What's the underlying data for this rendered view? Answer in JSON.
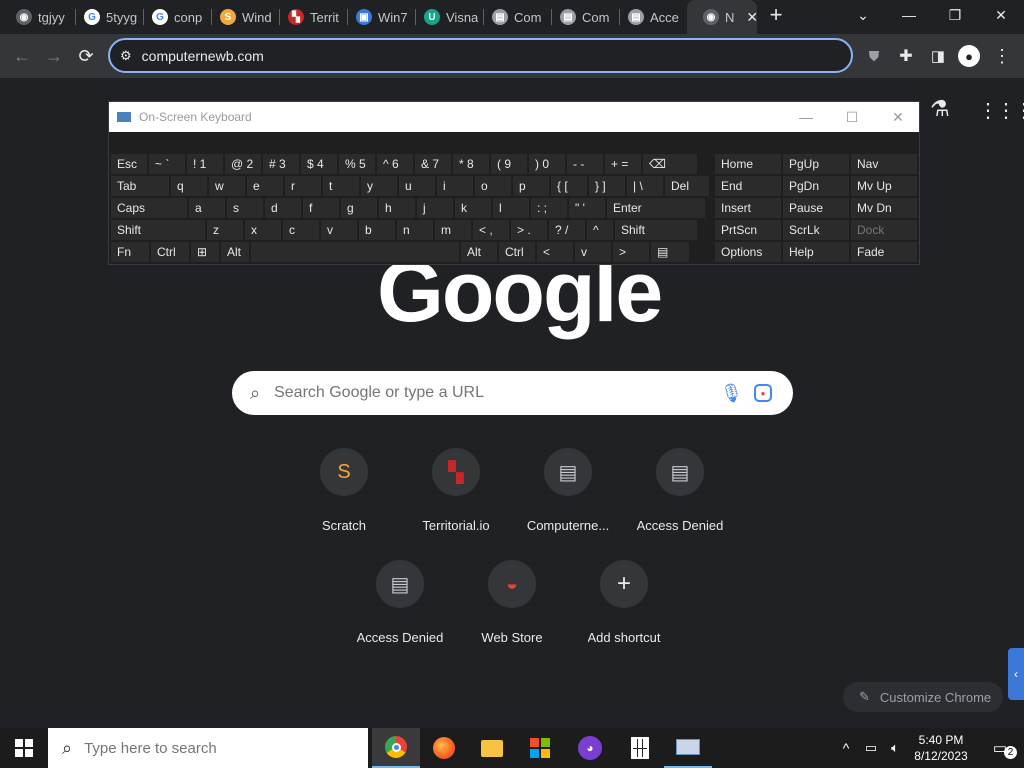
{
  "tabs": [
    {
      "title": "tgjyy",
      "icon": "chrome-icon"
    },
    {
      "title": "5tyyg",
      "icon": "google-icon"
    },
    {
      "title": "conp",
      "icon": "google-icon"
    },
    {
      "title": "Wind",
      "icon": "scratch-icon"
    },
    {
      "title": "Territ",
      "icon": "territorial-icon"
    },
    {
      "title": "Win7",
      "icon": "win7-icon"
    },
    {
      "title": "Visna",
      "icon": "visna-icon"
    },
    {
      "title": "Com",
      "icon": "computer-icon"
    },
    {
      "title": "Com",
      "icon": "computer-icon"
    },
    {
      "title": "Acce",
      "icon": "computer-icon"
    },
    {
      "title": "N",
      "icon": "chrome-icon"
    }
  ],
  "address": {
    "value": "computernewb.com"
  },
  "osk": {
    "title": "On-Screen Keyboard",
    "rows": [
      [
        [
          "Esc",
          ""
        ],
        [
          "~ `",
          ""
        ],
        [
          "! 1",
          ""
        ],
        [
          "@ 2",
          ""
        ],
        [
          "# 3",
          ""
        ],
        [
          "$ 4",
          ""
        ],
        [
          "% 5",
          ""
        ],
        [
          "^ 6",
          ""
        ],
        [
          "& 7",
          ""
        ],
        [
          "* 8",
          ""
        ],
        [
          "( 9",
          ""
        ],
        [
          ") 0",
          ""
        ],
        [
          "- -",
          ""
        ],
        [
          "+ =",
          ""
        ],
        [
          "⌫",
          ""
        ]
      ],
      [
        [
          "Tab",
          ""
        ],
        [
          "q",
          ""
        ],
        [
          "w",
          ""
        ],
        [
          "e",
          ""
        ],
        [
          "r",
          ""
        ],
        [
          "t",
          ""
        ],
        [
          "y",
          ""
        ],
        [
          "u",
          ""
        ],
        [
          "i",
          ""
        ],
        [
          "o",
          ""
        ],
        [
          "p",
          ""
        ],
        [
          "{ [",
          ""
        ],
        [
          "} ]",
          ""
        ],
        [
          "| \\",
          ""
        ],
        [
          "Del",
          ""
        ]
      ],
      [
        [
          "Caps",
          ""
        ],
        [
          "a",
          ""
        ],
        [
          "s",
          ""
        ],
        [
          "d",
          ""
        ],
        [
          "f",
          ""
        ],
        [
          "g",
          ""
        ],
        [
          "h",
          ""
        ],
        [
          "j",
          ""
        ],
        [
          "k",
          ""
        ],
        [
          "l",
          ""
        ],
        [
          ": ;",
          ""
        ],
        [
          "\" '",
          ""
        ],
        [
          "Enter",
          ""
        ]
      ],
      [
        [
          "Shift",
          ""
        ],
        [
          "z",
          ""
        ],
        [
          "x",
          ""
        ],
        [
          "c",
          ""
        ],
        [
          "v",
          ""
        ],
        [
          "b",
          ""
        ],
        [
          "n",
          ""
        ],
        [
          "m",
          ""
        ],
        [
          "< ,",
          ""
        ],
        [
          "> .",
          ""
        ],
        [
          "? /",
          ""
        ],
        [
          "^",
          ""
        ],
        [
          "Shift",
          ""
        ]
      ],
      [
        [
          "Fn",
          ""
        ],
        [
          "Ctrl",
          ""
        ],
        [
          "⊞",
          ""
        ],
        [
          "Alt",
          ""
        ],
        [
          "",
          ""
        ],
        [
          "Alt",
          ""
        ],
        [
          "Ctrl",
          ""
        ],
        [
          "<",
          ""
        ],
        [
          "v",
          ""
        ],
        [
          ">",
          ""
        ],
        [
          "▤",
          ""
        ]
      ]
    ],
    "nav": [
      [
        "Home",
        "PgUp",
        "Nav"
      ],
      [
        "End",
        "PgDn",
        "Mv Up"
      ],
      [
        "Insert",
        "Pause",
        "Mv Dn"
      ],
      [
        "PrtScn",
        "ScrLk",
        "Dock"
      ],
      [
        "Options",
        "Help",
        "Fade"
      ]
    ]
  },
  "logo": "Google",
  "search": {
    "placeholder": "Search Google or type a URL"
  },
  "shortcuts": [
    {
      "label": "Scratch",
      "icon": "scratch-icon"
    },
    {
      "label": "Territorial.io",
      "icon": "territorial-icon"
    },
    {
      "label": "Computerne...",
      "icon": "computer-icon"
    },
    {
      "label": "Access Denied",
      "icon": "computer-icon"
    },
    {
      "label": "Access Denied",
      "icon": "computer-icon"
    },
    {
      "label": "Web Store",
      "icon": "webstore-icon"
    },
    {
      "label": "Add shortcut",
      "icon": "plus-icon"
    }
  ],
  "customize": "Customize Chrome",
  "taskbar": {
    "search_placeholder": "Type here to search",
    "time": "5:40 PM",
    "date": "8/12/2023",
    "notif_count": "2"
  }
}
